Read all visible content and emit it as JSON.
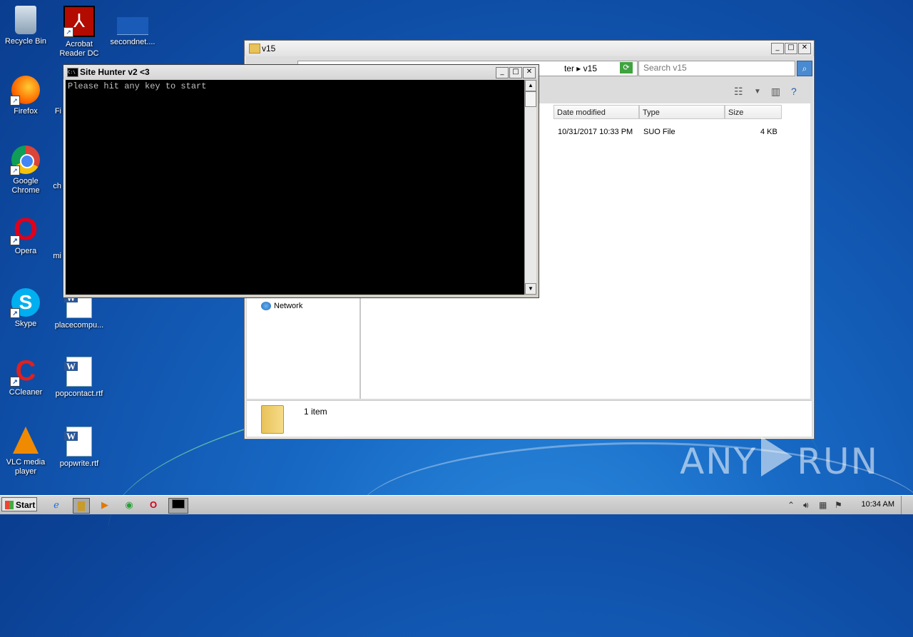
{
  "desktop": {
    "icons": [
      {
        "label": "Recycle Bin",
        "icon": "recycle-bin-icon"
      },
      {
        "label": "Acrobat Reader DC",
        "icon": "acrobat-icon"
      },
      {
        "label": "secondnet....",
        "icon": "file-icon"
      },
      {
        "label": "Firefox",
        "icon": "firefox-icon"
      },
      {
        "label": "Fi",
        "icon": "file-icon"
      },
      {
        "label": "Google Chrome",
        "icon": "chrome-icon"
      },
      {
        "label": "ch",
        "icon": "file-icon"
      },
      {
        "label": "Opera",
        "icon": "opera-icon"
      },
      {
        "label": "mi",
        "icon": "file-icon"
      },
      {
        "label": "Skype",
        "icon": "skype-icon"
      },
      {
        "label": "placecompu...",
        "icon": "word-doc-icon"
      },
      {
        "label": "CCleaner",
        "icon": "ccleaner-icon"
      },
      {
        "label": "popcontact.rtf",
        "icon": "word-doc-icon"
      },
      {
        "label": "VLC media player",
        "icon": "vlc-icon"
      },
      {
        "label": "popwrite.rtf",
        "icon": "word-doc-icon"
      }
    ]
  },
  "explorer": {
    "title": "v15",
    "address_tail": "ter ▸ v15",
    "search_placeholder": "Search v15",
    "columns": [
      "Date modified",
      "Type",
      "Size"
    ],
    "rows": [
      {
        "date": "10/31/2017 10:33 PM",
        "type": "SUO File",
        "size": "4 KB"
      }
    ],
    "nav_item": "Network",
    "status": "1 item"
  },
  "console": {
    "title": "Site Hunter v2 <3",
    "icon_text": "C:\\",
    "output": "Please hit any key to start"
  },
  "window_buttons": {
    "minimize": "_",
    "maximize": "□",
    "close": "✕"
  },
  "taskbar": {
    "start_label": "Start",
    "clock": "10:34 AM"
  },
  "watermark": {
    "left": "ANY",
    "right": "RUN"
  }
}
